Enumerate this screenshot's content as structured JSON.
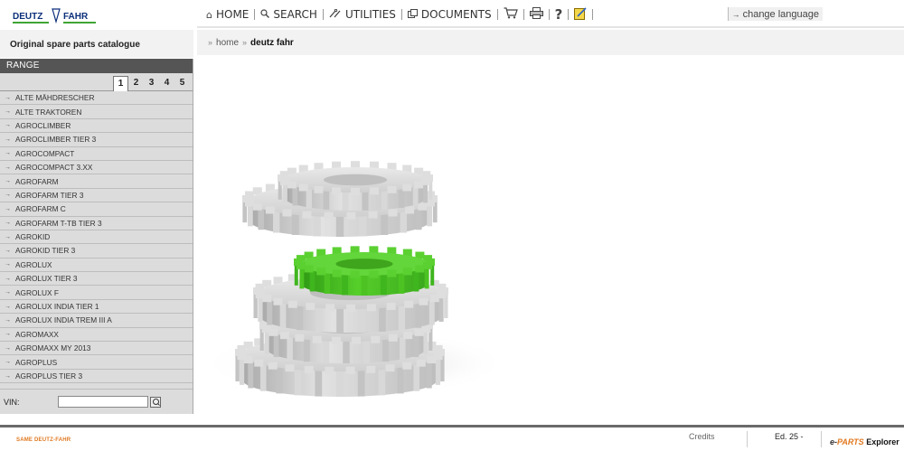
{
  "brand": {
    "logo_left": "DEUTZ",
    "logo_right": "FAHR"
  },
  "nav": {
    "home": "HOME",
    "search": "SEARCH",
    "utilities": "UTILITIES",
    "documents": "DOCUMENTS",
    "cart_icon": "cart-icon",
    "print_icon": "print-icon",
    "help_icon": "help-icon",
    "notes_icon": "notes-icon",
    "change_language": "change language"
  },
  "catalogue_title": "Original spare parts catalogue",
  "range": {
    "header": "RANGE",
    "pages": [
      "1",
      "2",
      "3",
      "4",
      "5"
    ],
    "active_page": "1",
    "items": [
      "ALTE MÄHDRESCHER",
      "ALTE TRAKTOREN",
      "AGROCLIMBER",
      "AGROCLIMBER TIER 3",
      "AGROCOMPACT",
      "AGROCOMPACT 3.XX",
      "AGROFARM",
      "AGROFARM TIER 3",
      "AGROFARM C",
      "AGROFARM T-TB TIER 3",
      "AGROKID",
      "AGROKID TIER 3",
      "AGROLUX",
      "AGROLUX TIER 3",
      "AGROLUX F",
      "AGROLUX INDIA TIER 1",
      "AGROLUX INDIA TREM III A",
      "AGROMAXX",
      "AGROMAXX MY 2013",
      "AGROPLUS",
      "AGROPLUS TIER 3"
    ]
  },
  "vin": {
    "label": "VIN:",
    "value": ""
  },
  "breadcrumb": {
    "home": "home",
    "current": "deutz fahr"
  },
  "footer": {
    "brand": "SAME DEUTZ-FAHR",
    "credits": "Credits",
    "edition": "Ed. 25 -",
    "product_e": "e-",
    "product_parts": "PARTS",
    "product_explorer": "Explorer"
  },
  "colors": {
    "gear_grey": "#d2d2d2",
    "gear_green": "#3fb51e",
    "accent_orange": "#e07820",
    "header_dark": "#555555"
  }
}
